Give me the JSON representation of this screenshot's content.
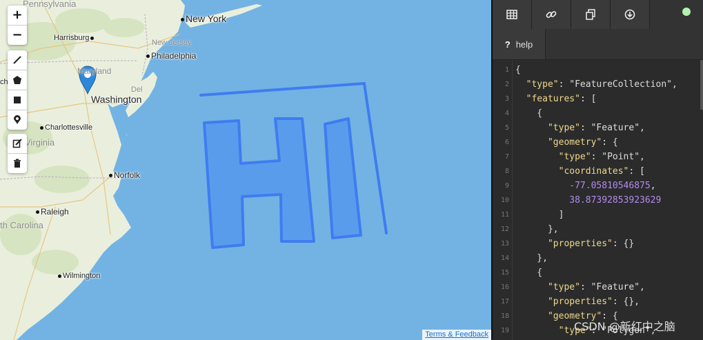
{
  "map": {
    "zoom_in": "+",
    "zoom_out": "−",
    "tools": [
      "line-tool",
      "polygon-tool",
      "rectangle-tool",
      "marker-tool"
    ],
    "edit_tools": [
      "edit-tool",
      "delete-tool"
    ],
    "places": {
      "pennsylvania": "Pennsylvania",
      "new_york": "New York",
      "harrisburg": "Harrisburg",
      "new_jersey": "New Jersey",
      "philadelphia": "Philadelphia",
      "maryland": "Maryland",
      "chester": "chester",
      "washington": "Washington",
      "del": "Del",
      "charlottesville": "Charlottesville",
      "virginia": "Virginia",
      "norfolk": "Norfolk",
      "raleigh": "Raleigh",
      "north_carolina": "th Carolina",
      "wilmington": "Wilmington"
    },
    "attribution": "Terms & Feedback",
    "colors": {
      "water": "#73b3e3",
      "land": "#e9efdc",
      "drawing": "#3f7cf0"
    }
  },
  "panel": {
    "tabs": [
      "table-icon",
      "link-icon",
      "copy-icon",
      "download-icon"
    ],
    "help_label": "help",
    "help_icon": "?",
    "status_color": "#b3f0b3",
    "lines": [
      {
        "n": "1",
        "t": "{"
      },
      {
        "n": "2",
        "t": "  \"type\": \"FeatureCollection\","
      },
      {
        "n": "3",
        "t": "  \"features\": ["
      },
      {
        "n": "4",
        "t": "    {"
      },
      {
        "n": "5",
        "t": "      \"type\": \"Feature\","
      },
      {
        "n": "6",
        "t": "      \"geometry\": {"
      },
      {
        "n": "7",
        "t": "        \"type\": \"Point\","
      },
      {
        "n": "8",
        "t": "        \"coordinates\": ["
      },
      {
        "n": "9",
        "t": "          -77.05810546875,"
      },
      {
        "n": "10",
        "t": "          38.87392853923629"
      },
      {
        "n": "11",
        "t": "        ]"
      },
      {
        "n": "12",
        "t": "      },"
      },
      {
        "n": "13",
        "t": "      \"properties\": {}"
      },
      {
        "n": "14",
        "t": "    },"
      },
      {
        "n": "15",
        "t": "    {"
      },
      {
        "n": "16",
        "t": "      \"type\": \"Feature\","
      },
      {
        "n": "17",
        "t": "      \"properties\": {},"
      },
      {
        "n": "18",
        "t": "      \"geometry\": {"
      },
      {
        "n": "19",
        "t": "        \"type\": \"Polygon\","
      }
    ]
  },
  "watermark": "CSDN @新红中之脑"
}
